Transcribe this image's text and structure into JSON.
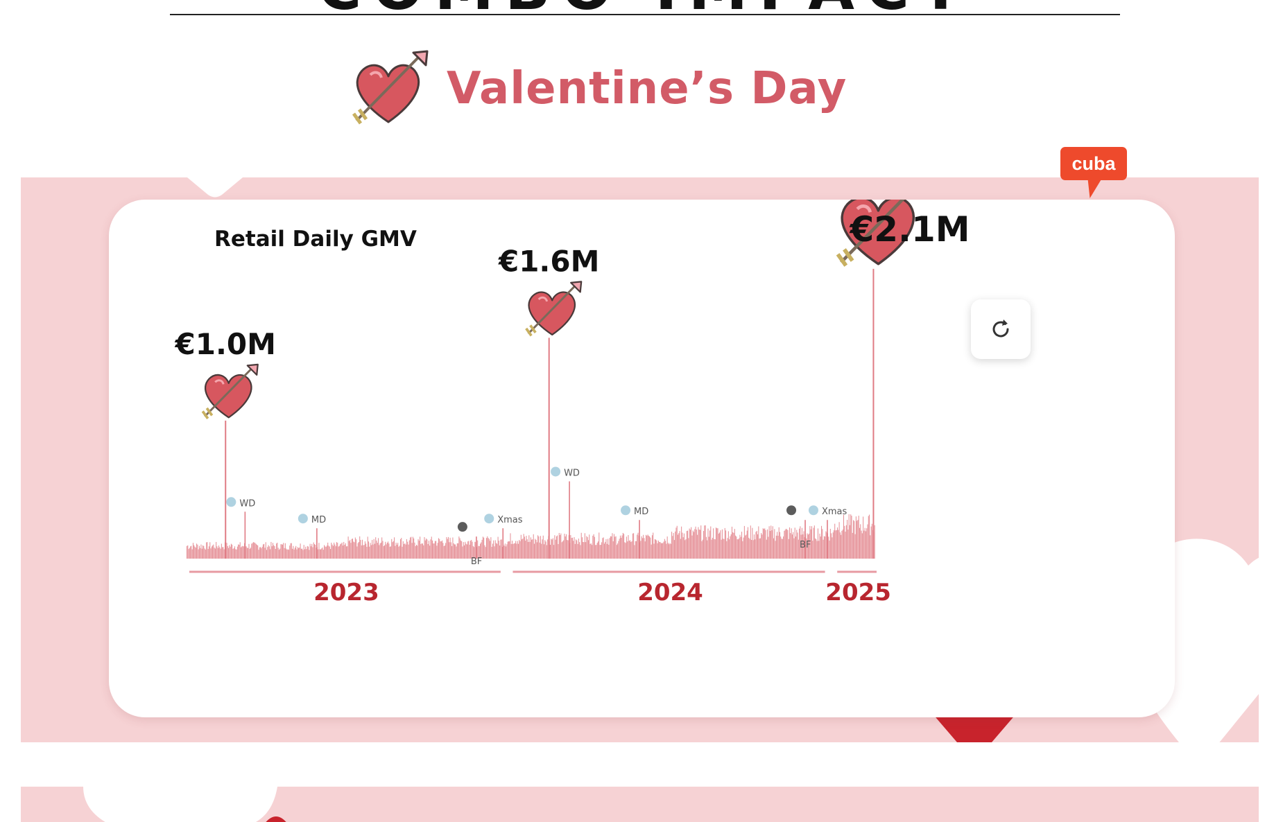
{
  "header": {
    "partial_title": "COMBO IMPACT"
  },
  "section": {
    "title": "Valentine’s Day"
  },
  "region_badge": {
    "label": "cuba"
  },
  "refresh": {
    "icon": "refresh-icon"
  },
  "colors": {
    "accent": "#d25b67",
    "bars": "#e07b84",
    "pink_bg": "#f6d2d4",
    "year_label": "#b8262f",
    "badge": "#ee4a2c"
  },
  "chart_data": {
    "type": "bar",
    "title": "Retail Daily GMV",
    "xlabel": "",
    "ylabel": "",
    "x_range": [
      "2023-01",
      "2025-02"
    ],
    "ylim": [
      0,
      2.3
    ],
    "unit": "€M",
    "grid": false,
    "years": [
      {
        "label": "2023",
        "start": "2023-01",
        "end": "2023-12"
      },
      {
        "label": "2024",
        "start": "2024-01",
        "end": "2024-12"
      },
      {
        "label": "2025",
        "start": "2025-01",
        "end": "2025-02"
      }
    ],
    "peaks": [
      {
        "event": "Valentine’s Day",
        "date": "2023-02-14",
        "value": 1.0,
        "label": "€1.0M"
      },
      {
        "event": "Valentine’s Day",
        "date": "2024-02-14",
        "value": 1.6,
        "label": "€1.6M"
      },
      {
        "event": "Valentine’s Day",
        "date": "2025-02-14",
        "value": 2.1,
        "label": "€2.1M"
      }
    ],
    "events": [
      {
        "label": "WD",
        "date": "2023-03-08",
        "value": 0.34
      },
      {
        "label": "MD",
        "date": "2023-05-28",
        "value": 0.22
      },
      {
        "label": "BF",
        "date": "2023-11-24",
        "value": 0.16
      },
      {
        "label": "Xmas",
        "date": "2023-12-24",
        "value": 0.22
      },
      {
        "label": "WD",
        "date": "2024-03-08",
        "value": 0.56
      },
      {
        "label": "MD",
        "date": "2024-05-26",
        "value": 0.28
      },
      {
        "label": "BF",
        "date": "2024-11-29",
        "value": 0.28
      },
      {
        "label": "Xmas",
        "date": "2024-12-24",
        "value": 0.28
      }
    ],
    "baseline": [
      {
        "period": "2023-H1",
        "typical": 0.09
      },
      {
        "period": "2023-H2",
        "typical": 0.12
      },
      {
        "period": "2024-H1",
        "typical": 0.14
      },
      {
        "period": "2024-H2",
        "typical": 0.18
      },
      {
        "period": "2025-Jan",
        "typical": 0.24
      }
    ]
  }
}
